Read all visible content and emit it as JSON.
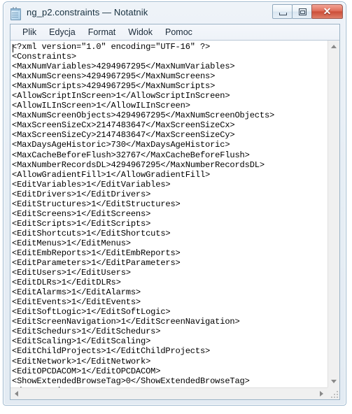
{
  "window": {
    "title": "ng_p2.constraints — Notatnik",
    "icon": "notepad-icon",
    "caption_buttons": {
      "minimize_label": "—",
      "maximize_label": "□",
      "close_label": "✕"
    },
    "colors": {
      "frame_border": "#9cb7cd",
      "titlebar_gradient_top": "#eef3f8",
      "close_button_red": "#cc4e38",
      "client_background": "#ffffff",
      "text": "#000000",
      "menu_text": "#1b2b3a",
      "scrollbar_track": "#f0f0f0",
      "scrollbar_arrow": "#8a8a8a"
    }
  },
  "menubar": {
    "items": [
      {
        "label": "Plik"
      },
      {
        "label": "Edycja"
      },
      {
        "label": "Format"
      },
      {
        "label": "Widok"
      },
      {
        "label": "Pomoc"
      }
    ]
  },
  "editor": {
    "lines": [
      "<?xml version=\"1.0\" encoding=\"UTF-16\" ?>",
      "<Constraints>",
      "<MaxNumVariables>4294967295</MaxNumVariables>",
      "<MaxNumScreens>4294967295</MaxNumScreens>",
      "<MaxNumScripts>4294967295</MaxNumScripts>",
      "<AllowScriptInScreen>1</AllowScriptInScreen>",
      "<AllowILInScreen>1</AllowILInScreen>",
      "<MaxNumScreenObjects>4294967295</MaxNumScreenObjects>",
      "<MaxScreenSizeCx>2147483647</MaxScreenSizeCx>",
      "<MaxScreenSizeCy>2147483647</MaxScreenSizeCy>",
      "<MaxDaysAgeHistoric>730</MaxDaysAgeHistoric>",
      "<MaxCacheBeforeFlush>32767</MaxCacheBeforeFlush>",
      "<MaxNumberRecordsDL>4294967295</MaxNumberRecordsDL>",
      "<AllowGradientFill>1</AllowGradientFill>",
      "<EditVariables>1</EditVariables>",
      "<EditDrivers>1</EditDrivers>",
      "<EditStructures>1</EditStructures>",
      "<EditScreens>1</EditScreens>",
      "<EditScripts>1</EditScripts>",
      "<EditShortcuts>1</EditShortcuts>",
      "<EditMenus>1</EditMenus>",
      "<EditEmbReports>1</EditEmbReports>",
      "<EditParameters>1</EditParameters>",
      "<EditUsers>1</EditUsers>",
      "<EditDLRs>1</EditDLRs>",
      "<EditAlarms>1</EditAlarms>",
      "<EditEvents>1</EditEvents>",
      "<EditSoftLogic>1</EditSoftLogic>",
      "<EditScreenNavigation>1</EditScreenNavigation>",
      "<EditSchedurs>1</EditSchedurs>",
      "<EditScaling>1</EditScaling>",
      "<EditChildProjects>1</EditChildProjects>",
      "<EditNetwork>1</EditNetwork>",
      "<EditOPCDACOM>1</EditOPCDACOM>",
      "<ShowExtendedBrowseTag>0</ShowExtendedBrowseTag>",
      "</Constraints>"
    ]
  },
  "scrollbars": {
    "vertical": {
      "up_arrow": "▲",
      "down_arrow": "▼"
    },
    "horizontal": {
      "left_arrow": "◀",
      "right_arrow": "▶"
    }
  }
}
